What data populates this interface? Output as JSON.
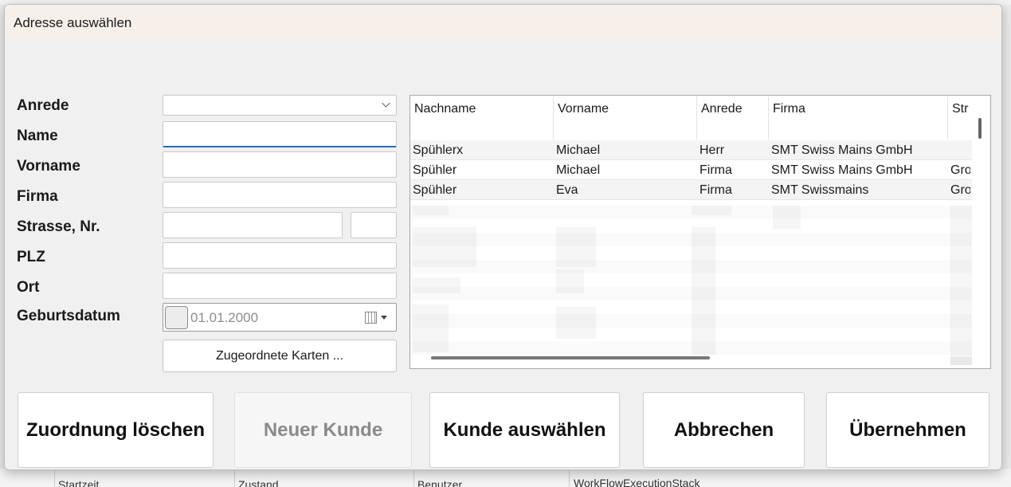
{
  "dialog": {
    "title": "Adresse auswählen"
  },
  "form": {
    "labels": {
      "anrede": "Anrede",
      "name": "Name",
      "vorname": "Vorname",
      "firma": "Firma",
      "strasse": "Strasse, Nr.",
      "plz": "PLZ",
      "ort": "Ort",
      "geburtsdatum": "Geburtsdatum"
    },
    "values": {
      "anrede": "",
      "name": "",
      "vorname": "",
      "firma": "",
      "strasse": "",
      "nr": "",
      "plz": "",
      "ort": "",
      "geburtsdatum": "01.01.2000"
    },
    "assigned_cards_label": "Zugeordnete Karten ..."
  },
  "grid": {
    "columns": [
      "Nachname",
      "Vorname",
      "Anrede",
      "Firma",
      "Str"
    ],
    "rows": [
      [
        "Spühlerx",
        "Michael",
        "Herr",
        "SMT Swiss Mains GmbH",
        ""
      ],
      [
        "Spühler",
        "Michael",
        "Firma",
        "SMT Swiss Mains GmbH",
        "Gro"
      ],
      [
        "Spühler",
        "Eva",
        "Firma",
        "SMT Swissmains",
        "Gro"
      ]
    ]
  },
  "actions": {
    "delete_assignment": "Zuordnung löschen",
    "new_customer": "Neuer Kunde",
    "select_customer": "Kunde auswählen",
    "cancel": "Abbrechen",
    "apply": "Übernehmen"
  },
  "background": {
    "col1": "Startzeit",
    "col2": "Zustand",
    "col3": "Benutzer",
    "col4": "WorkFlowExecutionStack"
  }
}
